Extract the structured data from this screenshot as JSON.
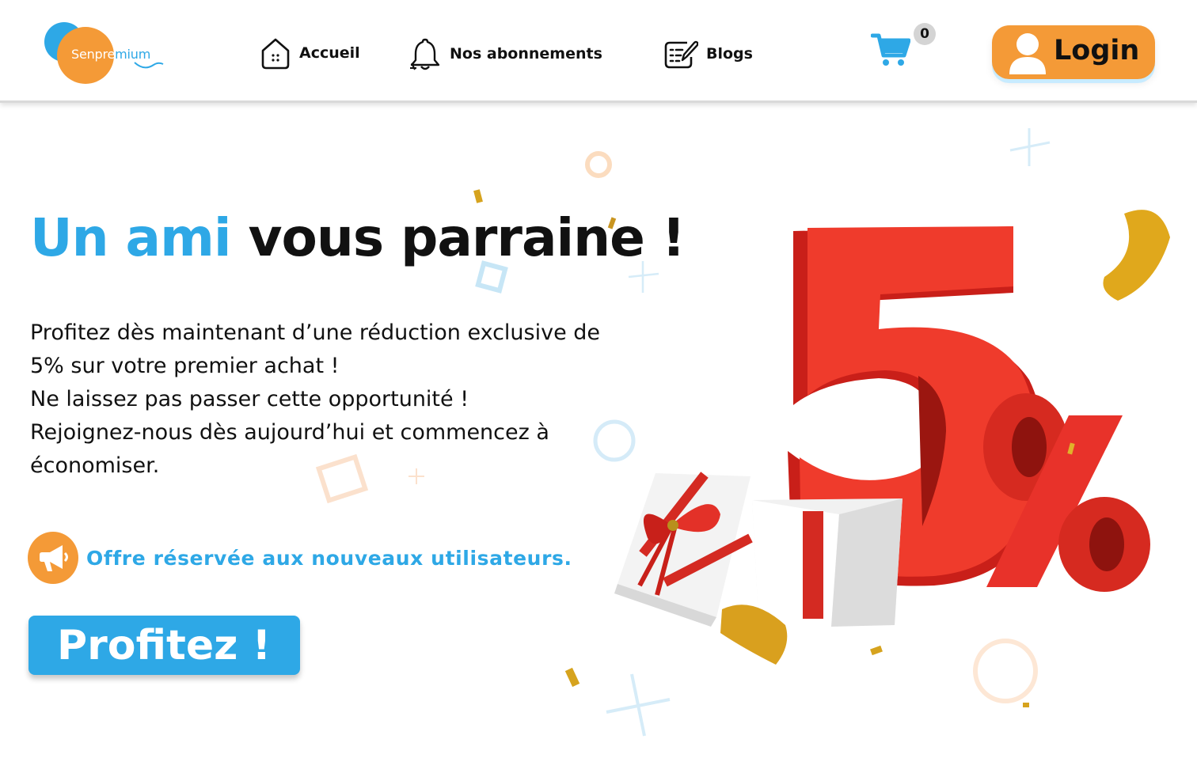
{
  "header": {
    "logo": {
      "text_part1": "Senpre",
      "text_part2": "mium",
      "colors": {
        "blue": "#2ea8e6",
        "orange": "#f49a37"
      }
    },
    "nav": [
      {
        "label": "Accueil",
        "icon": "home-icon"
      },
      {
        "label": "Nos abonnements",
        "icon": "bell-icon"
      },
      {
        "label": "Blogs",
        "icon": "edit-list-icon"
      }
    ],
    "cart": {
      "icon": "cart-icon",
      "count": "0"
    },
    "login": {
      "label": "Login",
      "icon": "user-icon"
    }
  },
  "hero": {
    "headline_blue": "Un ami",
    "headline_black": "vous parraine !",
    "paragraph_lines": [
      "Profitez dès maintenant d’une réduction exclusive de",
      "5% sur votre premier achat !",
      "Ne laissez pas passer cette opportunité !",
      "Rejoignez-nous dès aujourd’hui et commencez à",
      "économiser."
    ],
    "offer_text": "Offre réservée aux nouveaux utilisateurs.",
    "offer_icon": "megaphone-icon",
    "cta_label": "Profitez  !"
  },
  "illustration": {
    "big_text": "5%",
    "colors": {
      "red": "#e8322a",
      "red_dark": "#c01e18",
      "gold": "#e0a81c"
    }
  },
  "theme": {
    "accent_blue": "#2ea8e6",
    "accent_orange": "#f49a37"
  }
}
